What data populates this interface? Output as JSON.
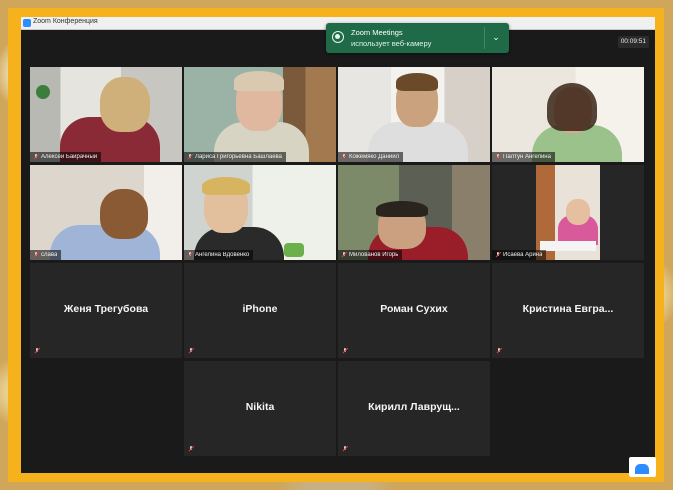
{
  "window": {
    "title": "Zoom Конференция"
  },
  "timer": "00:09:51",
  "toast": {
    "title": "Zoom Meetings",
    "body": "использует веб-камеру"
  },
  "video_tiles": [
    {
      "name": "Алексей Байрачный"
    },
    {
      "name": "Лариса Григорьевна Башлаева"
    },
    {
      "name": "Кожемяко Даниил"
    },
    {
      "name": "Палтун Ангелина"
    },
    {
      "name": "слава"
    },
    {
      "name": "Ангелина Вдовенко"
    },
    {
      "name": "Милованов Игорь"
    },
    {
      "name": "Исаева Арина"
    }
  ],
  "no_video_tiles": [
    {
      "name": "Женя Трегубова"
    },
    {
      "name": "iPhone"
    },
    {
      "name": "Роман Сухих"
    },
    {
      "name": "Кристина Евгра..."
    },
    {
      "name": "Nikita"
    },
    {
      "name": "Кирилл Лаврущ..."
    }
  ],
  "colors": {
    "frame": "#f6b21c",
    "active_speaker": "#e6d94a",
    "toast": "#1f6b48",
    "muted": "#e03e3e"
  }
}
